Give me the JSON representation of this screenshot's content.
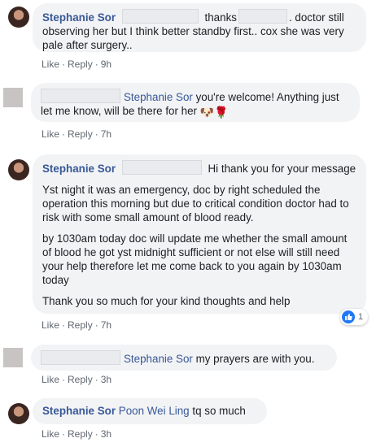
{
  "comments": [
    {
      "author": "Stephanie Sor",
      "text_a": "thanks",
      "text_b": ". doctor still observing her but I think better standby first.. cox she was very pale after surgery..",
      "like": "Like",
      "reply": "Reply",
      "time": "9h"
    },
    {
      "mention": "Stephanie Sor",
      "text": " you're welcome! Anything just let me know, will be there for her ",
      "emoji_1": "🐶",
      "emoji_2": "🌹",
      "like": "Like",
      "reply": "Reply",
      "time": "7h"
    },
    {
      "author": "Stephanie Sor",
      "text_head": "Hi thank you for your message",
      "paragraphs": [
        "Yst night it was an emergency, doc by right scheduled the operation this morning but due to critical condition doctor had to risk with some small amount of blood ready.",
        "by 1030am today doc will update me whether the small amount of blood he got yst midnight sufficient or not else will still need your help therefore let me come back to you again by 1030am today",
        "Thank you so much for your kind thoughts and help"
      ],
      "reaction_count": "1",
      "like": "Like",
      "reply": "Reply",
      "time": "7h"
    },
    {
      "mention": "Stephanie Sor",
      "text": " my prayers are with you.",
      "like": "Like",
      "reply": "Reply",
      "time": "3h"
    },
    {
      "author": "Stephanie Sor",
      "mention": "Poon Wei Ling",
      "text": " tq so much",
      "like": "Like",
      "reply": "Reply",
      "time": "3h"
    }
  ],
  "separator": "·"
}
